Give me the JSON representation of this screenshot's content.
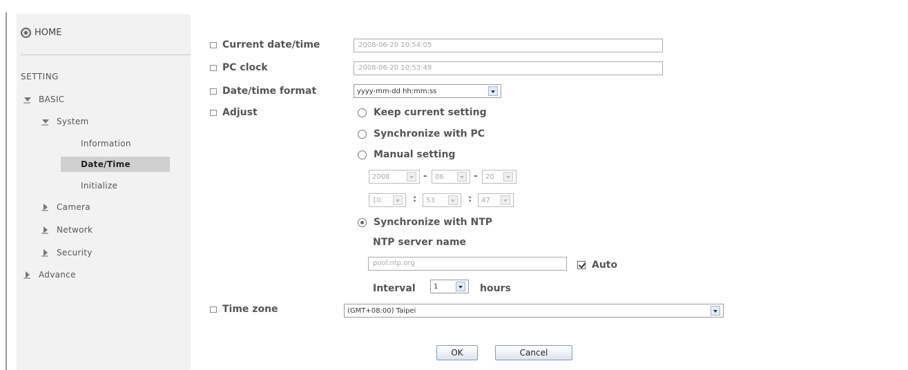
{
  "sidebar": {
    "home_label": "HOME",
    "setting_title": "SETTING",
    "basic_label": "BASIC",
    "system_label": "System",
    "system_items": [
      "Information",
      "Date/Time",
      "Initialize"
    ],
    "camera_label": "Camera",
    "network_label": "Network",
    "security_label": "Security",
    "advance_label": "Advance"
  },
  "form": {
    "current_datetime_label": "Current date/time",
    "current_datetime_value": "2008-06-20   10:54:05",
    "pc_clock_label": "PC clock",
    "pc_clock_value": "2008-06-20   10:53:49",
    "format_label": "Date/time format",
    "format_value": "yyyy-mm-dd hh:mm:ss",
    "adjust_label": "Adjust",
    "opt_keep": "Keep current setting",
    "opt_sync_pc": "Synchronize with PC",
    "opt_manual": "Manual setting",
    "manual": {
      "year": "2008",
      "month": "06",
      "day": "20",
      "hour": "10",
      "minute": "53",
      "second": "47",
      "date_sep": "-",
      "time_sep": ":"
    },
    "opt_sync_ntp": "Synchronize with NTP",
    "ntp_server_label": "NTP server name",
    "ntp_server_value": "pool.ntp.org",
    "auto_label": "Auto",
    "interval_label": "Interval",
    "interval_value": "1",
    "interval_unit": "hours",
    "timezone_label": "Time zone",
    "timezone_value": "(GMT+08:00) Taipei",
    "ok_label": "OK",
    "cancel_label": "Cancel"
  }
}
